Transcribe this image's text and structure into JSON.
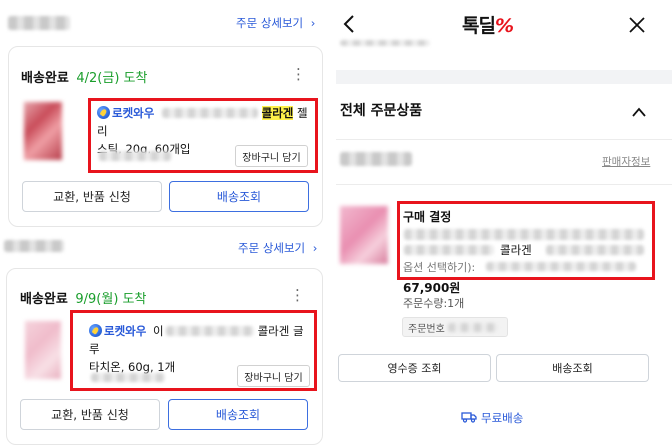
{
  "left": {
    "order1": {
      "detail_link": "주문 상세보기",
      "status": "배송완료",
      "date": "4/2(금) 도착",
      "rocket_label": "로켓와우",
      "name_highlight": "콜라겐",
      "name_tail": " 젤리",
      "name_line2": "스틱, 20g, 60개입",
      "cart_button": "장바구니 담기",
      "exchange_button": "교환, 반품 신청",
      "tracking_button": "배송조회"
    },
    "order2": {
      "detail_link": "주문 상세보기",
      "status": "배송완료",
      "date": "9/9(월) 도착",
      "rocket_label": "로켓와우",
      "name_prefix": "이",
      "name_tail": "콜라겐 글루",
      "name_line2": "타치온, 60g, 1개",
      "cart_button": "장바구니 담기",
      "exchange_button": "교환, 반품 신청",
      "tracking_button": "배송조회"
    }
  },
  "right": {
    "header": {
      "logo_text": "톡딜",
      "logo_symbol": "%"
    },
    "section_title": "전체 주문상품",
    "seller_info_link": "판매자정보",
    "item": {
      "status": "구매 결정",
      "product_name": "콜라겐",
      "option_label": "옵션 선택하기):",
      "price": "67,900원",
      "quantity": "주문수량:1개",
      "order_number_label": "주문번호"
    },
    "receipt_button": "영수증 조회",
    "tracking_button": "배송조회",
    "free_shipping": "무료배송",
    "colors": {
      "accent": "#e8141d",
      "link": "#2a5ad8",
      "arrived": "#1a9e2c"
    },
    "icons": [
      "back-arrow-icon",
      "close-icon",
      "chevron-up-icon",
      "truck-icon"
    ]
  }
}
